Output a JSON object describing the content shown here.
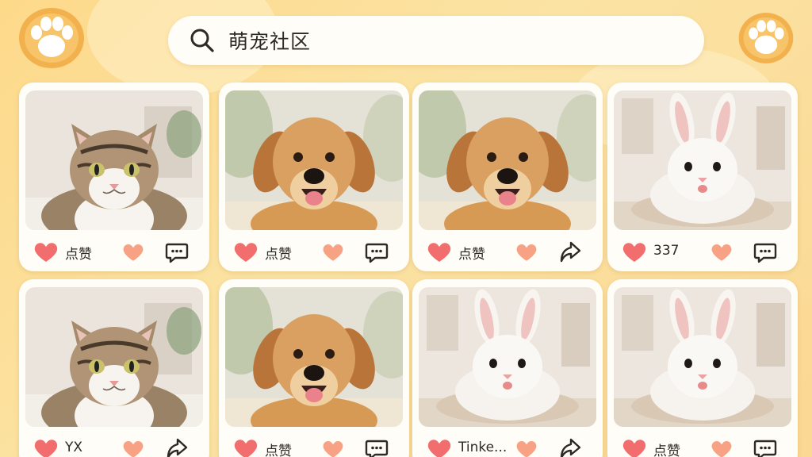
{
  "header": {
    "search": {
      "query": "萌宠社区"
    },
    "icons": [
      "paw-icon",
      "search-icon",
      "paw-icon"
    ]
  },
  "colors": {
    "background": "#fdd98a",
    "paw_fill": "#ffffff",
    "paw_ring": "#f3b14e",
    "heart": "#f26d6d",
    "heart_light": "#f7a285",
    "card": "#fffdf8"
  },
  "posts": [
    {
      "animal": "cat",
      "like_label": "点赞",
      "action_icon": "comment-icon"
    },
    {
      "animal": "dog",
      "like_label": "点赞",
      "action_icon": "comment-icon"
    },
    {
      "animal": "dog",
      "like_label": "点赞",
      "action_icon": "share-icon"
    },
    {
      "animal": "rabbit",
      "like_label": "337",
      "action_icon": "comment-icon"
    },
    {
      "animal": "cat",
      "like_label": "YX",
      "action_icon": "share-icon"
    },
    {
      "animal": "dog",
      "like_label": "点赞",
      "action_icon": "comment-icon"
    },
    {
      "animal": "rabbit",
      "like_label": "Tinke...",
      "action_icon": "share-icon"
    },
    {
      "animal": "rabbit",
      "like_label": "点赞",
      "action_icon": "comment-icon"
    }
  ]
}
